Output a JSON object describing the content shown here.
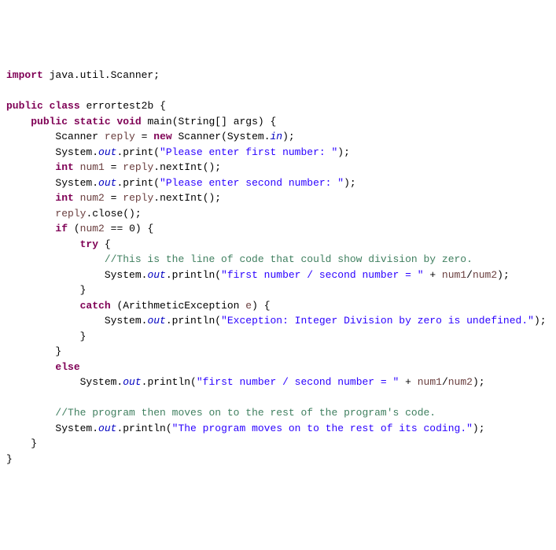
{
  "code": {
    "l1_kw1": "import",
    "l1_rest": " java.util.Scanner;",
    "l3_kw1": "public",
    "l3_kw2": "class",
    "l3_cls": "errortest2b",
    "l3_brace": " {",
    "l4_kw1": "public",
    "l4_kw2": "static",
    "l4_kw3": "void",
    "l4_m": " main(String[] args) {",
    "l5a": "Scanner ",
    "l5v": "reply",
    "l5b": " = ",
    "l5kw": "new",
    "l5c": " Scanner(System.",
    "l5f": "in",
    "l5d": ");",
    "l6a": "System.",
    "l6f": "out",
    "l6b": ".print(",
    "l6s": "\"Please enter first number: \"",
    "l6c": ");",
    "l7kw": "int",
    "l7a": " ",
    "l7v": "num1",
    "l7b": " = ",
    "l7v2": "reply",
    "l7c": ".nextInt();",
    "l8a": "System.",
    "l8f": "out",
    "l8b": ".print(",
    "l8s": "\"Please enter second number: \"",
    "l8c": ");",
    "l9kw": "int",
    "l9a": " ",
    "l9v": "num2",
    "l9b": " = ",
    "l9v2": "reply",
    "l9c": ".nextInt();",
    "l10v": "reply",
    "l10a": ".close();",
    "l11kw": "if",
    "l11a": " (",
    "l11v": "num2",
    "l11b": " == 0) {",
    "l12kw": "try",
    "l12a": " {",
    "l13c": "//This is the line of code that could show division by zero.",
    "l14a": "System.",
    "l14f": "out",
    "l14b": ".println(",
    "l14s": "\"first number / second number = \"",
    "l14c": " + ",
    "l14v1": "num1",
    "l14d": "/",
    "l14v2": "num2",
    "l14e": ");",
    "l15a": "}",
    "l16kw": "catch",
    "l16a": " (ArithmeticException ",
    "l16v": "e",
    "l16b": ") {",
    "l17a": "System.",
    "l17f": "out",
    "l17b": ".println(",
    "l17s": "\"Exception: Integer Division by zero is undefined.\"",
    "l17c": ");",
    "l18a": "}",
    "l19a": "}",
    "l20kw": "else",
    "l21a": "System.",
    "l21f": "out",
    "l21b": ".println(",
    "l21s": "\"first number / second number = \"",
    "l21c": " + ",
    "l21v1": "num1",
    "l21d": "/",
    "l21v2": "num2",
    "l21e": ");",
    "l23c": "//The program then moves on to the rest of the program's code.",
    "l24a": "System.",
    "l24f": "out",
    "l24b": ".println(",
    "l24s": "\"The program moves on to the rest of its coding.\"",
    "l24c": ");",
    "l25a": "}",
    "l26a": "}"
  }
}
